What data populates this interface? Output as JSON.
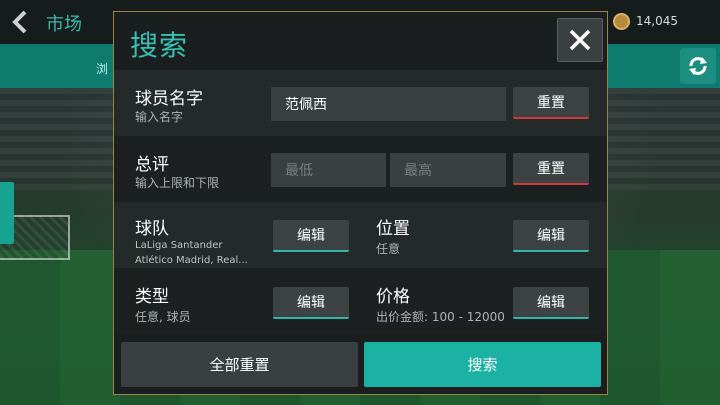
{
  "header": {
    "title": "市场",
    "coins": "14,045",
    "sub_tab": "浏"
  },
  "dialog": {
    "title": "搜索",
    "player_name": {
      "label": "球员名字",
      "hint": "输入名字",
      "value": "范佩西",
      "reset_label": "重置"
    },
    "rating": {
      "label": "总评",
      "hint": "输入上限和下限",
      "min_placeholder": "最低",
      "max_placeholder": "最高",
      "reset_label": "重置"
    },
    "team": {
      "label": "球队",
      "value_line1": "LaLiga Santander",
      "value_line2": "Atlético Madrid, Real...",
      "edit_label": "编辑"
    },
    "position": {
      "label": "位置",
      "value": "任意",
      "edit_label": "编辑"
    },
    "type": {
      "label": "类型",
      "value": "任意, 球员",
      "edit_label": "编辑"
    },
    "price": {
      "label": "价格",
      "value": "出价金额: 100 - 12000",
      "edit_label": "编辑"
    },
    "reset_all_label": "全部重置",
    "search_label": "搜索"
  },
  "colors": {
    "accent": "#39c0b3",
    "search_button": "#1bb2a3",
    "reset_underline": "#d03a3a",
    "edit_underline": "#2fb8a8",
    "dialog_border": "#9c8446"
  }
}
